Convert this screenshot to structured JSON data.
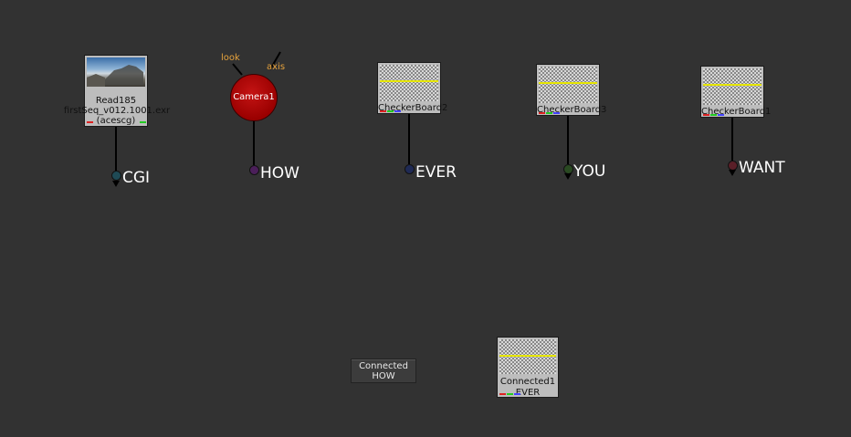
{
  "nodes": {
    "read": {
      "name": "Read185",
      "file": "firstSeq_v012.1001.exr",
      "colorspace": "(acescg)"
    },
    "camera": {
      "name": "Camera1",
      "input_look": "look",
      "input_axis": "axis"
    },
    "checkerboards": [
      {
        "name": "CheckerBoard2"
      },
      {
        "name": "CheckerBoard3"
      },
      {
        "name": "CheckerBoard1"
      }
    ],
    "connected1": {
      "name": "Connected1",
      "sub": "EVER"
    },
    "connected_how": {
      "line1": "Connected",
      "line2": "HOW"
    }
  },
  "dots": [
    {
      "label": "CGI",
      "color": "#1f4a55"
    },
    {
      "label": "HOW",
      "color": "#4b1f5a"
    },
    {
      "label": "EVER",
      "color": "#1f2a55"
    },
    {
      "label": "YOU",
      "color": "#2a4a22"
    },
    {
      "label": "WANT",
      "color": "#5a1f28"
    }
  ],
  "colors": {
    "background": "#323232",
    "camera": "#b10000",
    "checker_line": "#e6e600",
    "input_label": "#e6a23c"
  }
}
